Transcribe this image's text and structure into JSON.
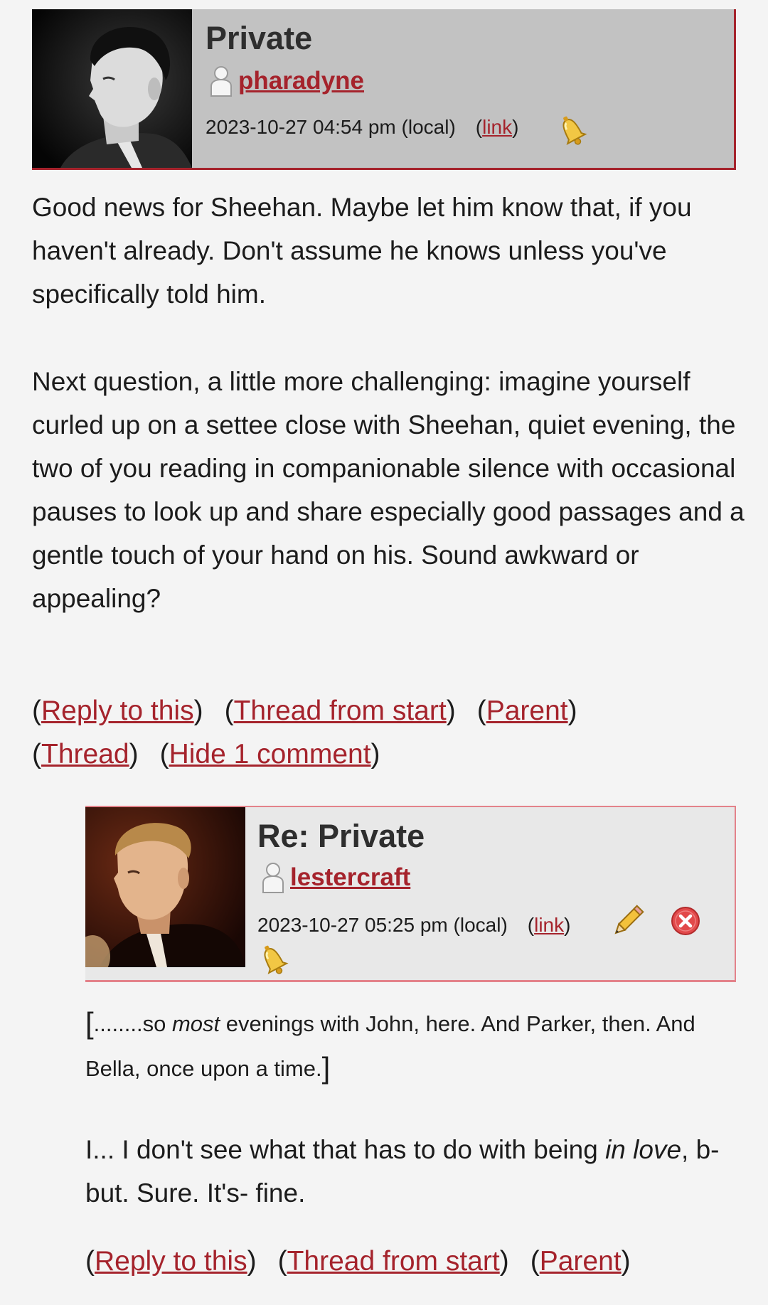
{
  "comment1": {
    "subject": "Private",
    "username": "pharadyne",
    "timestamp": "2023-10-27 04:54 pm (local)",
    "link_label": "link",
    "paragraph1": "Good news for Sheehan. Maybe let him know that, if you haven't already. Don't assume he knows unless you've specifically told him.",
    "paragraph2": "Next question, a little more challenging: imagine yourself curled up on a settee close with Sheehan, quiet evening, the two of you reading in companionable silence with occasional pauses to look up and share especially good passages and a gentle touch of your hand on his. Sound awkward or appealing?",
    "actions": {
      "reply": "Reply to this",
      "thread_from_start": "Thread from start",
      "parent": "Parent",
      "thread": "Thread",
      "hide": "Hide 1 comment"
    }
  },
  "comment2": {
    "subject": "Re: Private",
    "username": "lestercraft",
    "timestamp": "2023-10-27 05:25 pm (local)",
    "link_label": "link",
    "quote_prefix": "........so ",
    "quote_emphasis": "most",
    "quote_rest": " evenings with John, here. And Parker, then. And Bella, once upon a time.",
    "para_start": "I... I don't see what that has to do with being ",
    "para_emphasis": "in love",
    "para_end": ", b-but. Sure. It's- fine.",
    "actions": {
      "reply": "Reply to this",
      "thread_from_start": "Thread from start",
      "parent": "Parent"
    }
  },
  "colors": {
    "link": "#a5232c",
    "header1_bg": "#c2c2c2",
    "header2_bg": "#e8e8e8",
    "header2_border": "#e3828a",
    "page_bg": "#f4f4f4"
  },
  "icons": [
    "user-icon",
    "bell-icon",
    "edit-icon",
    "delete-icon"
  ]
}
